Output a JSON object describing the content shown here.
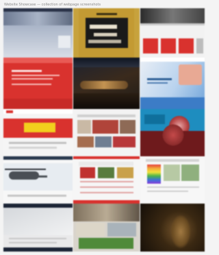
{
  "page": {
    "caption": "Website Showcase — collection of webpage screenshots"
  },
  "colors": {
    "red": "#d9322e",
    "gold": "#c7a23d",
    "yellow": "#f2cf1d",
    "blue_banner": "#1e8dbf",
    "navy": "#1c2536"
  },
  "thumbnails": [
    {
      "name": "city-hero-site"
    },
    {
      "name": "black-gold-brand-site"
    },
    {
      "name": "red-cards-grid-site"
    },
    {
      "name": "red-landing-site"
    },
    {
      "name": "dark-landscape-site"
    },
    {
      "name": "blue-product-site"
    },
    {
      "name": "yellow-banner-site"
    },
    {
      "name": "photo-mosaic-site"
    },
    {
      "name": "virus-banner-site"
    },
    {
      "name": "helicopter-site"
    },
    {
      "name": "red-news-site"
    },
    {
      "name": "rainbow-flag-site"
    },
    {
      "name": "desk-hero-site"
    },
    {
      "name": "collage-blog-site"
    },
    {
      "name": "sculpture-photo-site"
    }
  ]
}
